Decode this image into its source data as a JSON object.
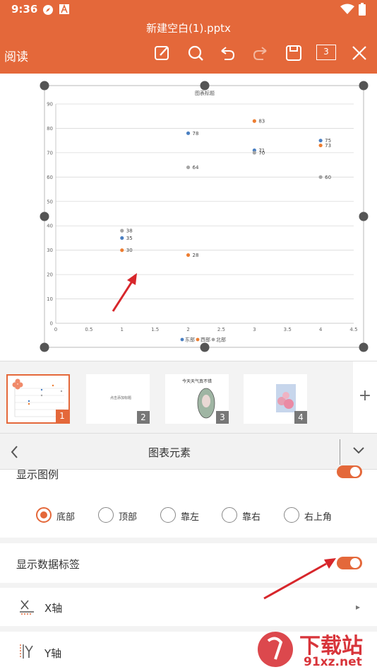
{
  "status_bar": {
    "time": "9:36",
    "icons": [
      "compass-icon",
      "a-badge-icon",
      "wifi-icon",
      "battery-icon"
    ]
  },
  "header": {
    "title": "新建空白(1).pptx",
    "read_label": "阅读",
    "toolbar": [
      "edit-icon",
      "search-icon",
      "undo-icon",
      "redo-icon",
      "save-icon",
      "page-count-icon",
      "close-icon"
    ],
    "page_count": "3"
  },
  "chart_data": {
    "type": "scatter",
    "title": "图表标题",
    "xlim": [
      0,
      4.5
    ],
    "ylim": [
      0,
      90
    ],
    "x_ticks": [
      "0",
      "0.5",
      "1",
      "1.5",
      "2",
      "2.5",
      "3",
      "3.5",
      "4",
      "4.5"
    ],
    "y_ticks": [
      "0",
      "10",
      "20",
      "30",
      "40",
      "50",
      "60",
      "70",
      "80",
      "90"
    ],
    "grid": "horizontal",
    "legend": "bottom",
    "series": [
      {
        "name": "东部",
        "color": "#4a7fc1",
        "points": [
          [
            1,
            35
          ],
          [
            2,
            78
          ],
          [
            3,
            71
          ],
          [
            4,
            75
          ]
        ],
        "labels": [
          "35",
          "78",
          "71",
          "75"
        ]
      },
      {
        "name": "西部",
        "color": "#ed7d31",
        "points": [
          [
            1,
            30
          ],
          [
            2,
            28
          ],
          [
            3,
            83
          ],
          [
            4,
            73
          ]
        ],
        "labels": [
          "30",
          "28",
          "83",
          "73"
        ]
      },
      {
        "name": "北部",
        "color": "#a5a5a5",
        "points": [
          [
            1,
            38
          ],
          [
            2,
            64
          ],
          [
            3,
            70
          ],
          [
            4,
            60
          ]
        ],
        "labels": [
          "38",
          "64",
          "70",
          "60"
        ]
      }
    ]
  },
  "thumbnails": [
    {
      "num": "1",
      "selected": true
    },
    {
      "num": "2",
      "selected": false,
      "text": "点击添加标题"
    },
    {
      "num": "3",
      "selected": false,
      "text": "今天天气真不错"
    },
    {
      "num": "4",
      "selected": false
    }
  ],
  "panel": {
    "title": "图表元素",
    "show_legend_label": "显示图例",
    "legend_positions": [
      "底部",
      "顶部",
      "靠左",
      "靠右",
      "右上角"
    ],
    "legend_selected": "底部",
    "show_data_labels_label": "显示数据标签",
    "x_axis_label": "X轴",
    "y_axis_label": "Y轴"
  },
  "watermark": {
    "text": "下载站",
    "url_text": "91xz.net"
  },
  "colors": {
    "accent": "#e4683a",
    "red_arrow": "#d7262b"
  }
}
